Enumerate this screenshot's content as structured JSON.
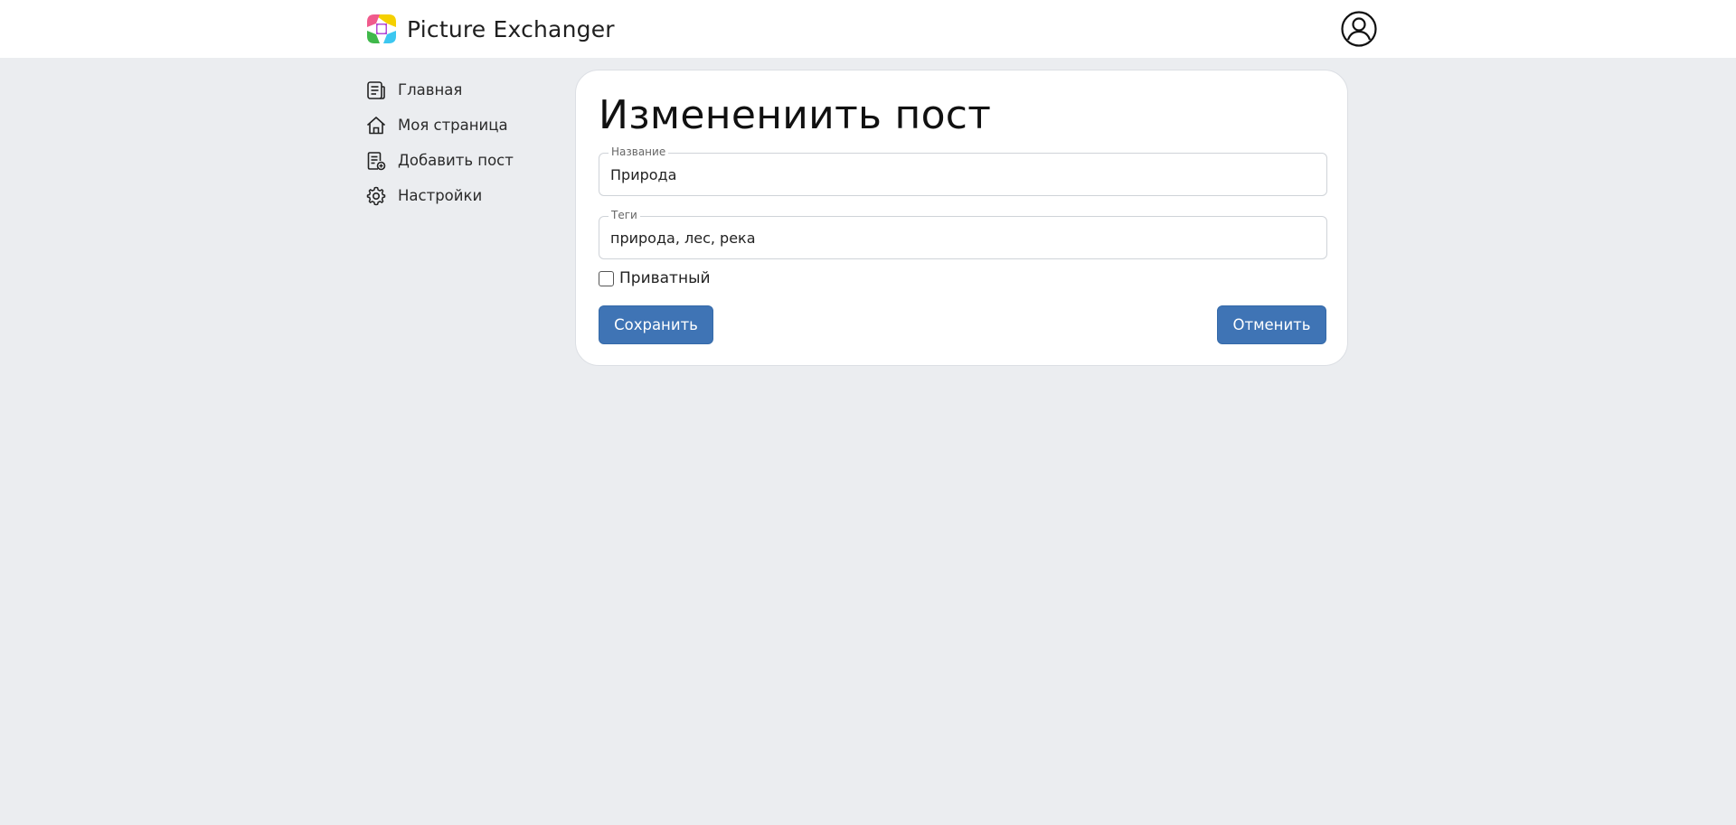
{
  "header": {
    "brand_title": "Picture Exchanger",
    "logo_icon": "picture-exchanger-logo",
    "user_icon": "user-circle-icon"
  },
  "sidebar": {
    "items": [
      {
        "label": "Главная",
        "icon": "news-icon"
      },
      {
        "label": "Моя страница",
        "icon": "home-icon"
      },
      {
        "label": "Добавить пост",
        "icon": "add-document-icon"
      },
      {
        "label": "Настройки",
        "icon": "gear-icon"
      }
    ]
  },
  "form": {
    "title": "Изменениить пост",
    "name_field": {
      "legend": "Название",
      "value": "Природа"
    },
    "tags_field": {
      "legend": "Теги",
      "value": "природа, лес, река"
    },
    "private_checkbox": {
      "label": "Приватный",
      "checked": false
    },
    "save_label": "Сохранить",
    "cancel_label": "Отменить"
  },
  "colors": {
    "page_background": "#ebedf0",
    "card_background": "#ffffff",
    "button_primary": "#3f74b5"
  }
}
